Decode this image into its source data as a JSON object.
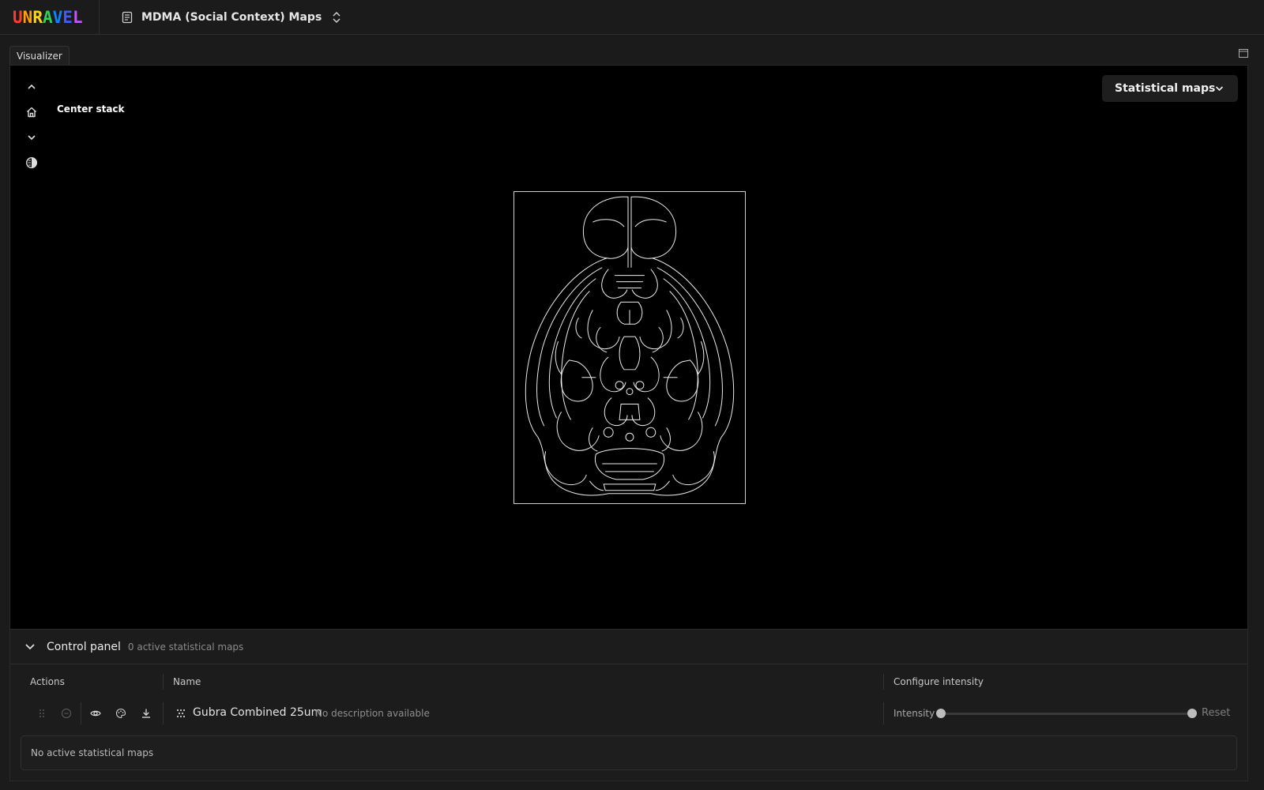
{
  "app": {
    "logo_letters": [
      {
        "ch": "U",
        "color": "#ff3b30"
      },
      {
        "ch": "N",
        "color": "#ff9f0a"
      },
      {
        "ch": "R",
        "color": "#ffd60a"
      },
      {
        "ch": "A",
        "color": "#30d158"
      },
      {
        "ch": "V",
        "color": "#0a84ff"
      },
      {
        "ch": "E",
        "color": "#3f5bff"
      },
      {
        "ch": "L",
        "color": "#bf5af2"
      }
    ],
    "document_title": "MDMA (Social Context) Maps"
  },
  "tab": {
    "label": "Visualizer"
  },
  "viewer": {
    "tooltip": "Center stack",
    "dropdown_label": "Statistical maps"
  },
  "control_panel": {
    "title": "Control panel",
    "subtitle": "0 active statistical maps",
    "headers": {
      "actions": "Actions",
      "name": "Name",
      "intensity": "Configure intensity"
    },
    "row": {
      "name": "Gubra Combined 25um",
      "description": "No description available",
      "intensity_label": "Intensity",
      "reset_label": "Reset",
      "intensity_min": 0,
      "intensity_max": 1
    },
    "empty_message": "No active statistical maps"
  },
  "colors": {
    "background": "#1b1b1b",
    "viewer_bg": "#000000",
    "accent": "#bdbdbd"
  }
}
